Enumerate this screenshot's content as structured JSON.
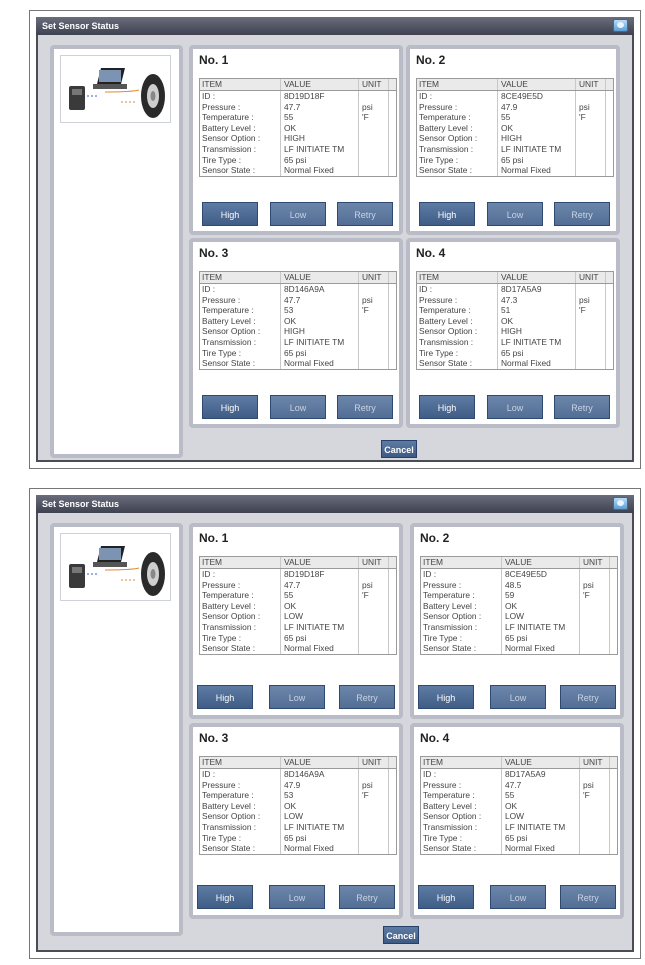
{
  "screens": [
    {
      "title": "Set Sensor Status",
      "cancel_label": "Cancel",
      "sensors": [
        {
          "no": "No. 1",
          "rows": [
            [
              "ID :",
              "8D19D18F",
              ""
            ],
            [
              "Pressure :",
              "47.7",
              "psi"
            ],
            [
              "Temperature :",
              "55",
              "'F"
            ],
            [
              "Battery Level :",
              "OK",
              ""
            ],
            [
              "Sensor Option :",
              "HIGH",
              ""
            ],
            [
              "Transmission :",
              "LF INITIATE TM",
              ""
            ],
            [
              "Tire Type :",
              "65 psi",
              ""
            ],
            [
              "Sensor State :",
              "Normal Fixed",
              ""
            ]
          ]
        },
        {
          "no": "No. 2",
          "rows": [
            [
              "ID :",
              "8CE49E5D",
              ""
            ],
            [
              "Pressure :",
              "47.9",
              "psi"
            ],
            [
              "Temperature :",
              "55",
              "'F"
            ],
            [
              "Battery Level :",
              "OK",
              ""
            ],
            [
              "Sensor Option :",
              "HIGH",
              ""
            ],
            [
              "Transmission :",
              "LF INITIATE TM",
              ""
            ],
            [
              "Tire Type :",
              "65 psi",
              ""
            ],
            [
              "Sensor State :",
              "Normal Fixed",
              ""
            ]
          ]
        },
        {
          "no": "No. 3",
          "rows": [
            [
              "ID :",
              "8D146A9A",
              ""
            ],
            [
              "Pressure :",
              "47.7",
              "psi"
            ],
            [
              "Temperature :",
              "53",
              "'F"
            ],
            [
              "Battery Level :",
              "OK",
              ""
            ],
            [
              "Sensor Option :",
              "HIGH",
              ""
            ],
            [
              "Transmission :",
              "LF INITIATE TM",
              ""
            ],
            [
              "Tire Type :",
              "65 psi",
              ""
            ],
            [
              "Sensor State :",
              "Normal Fixed",
              ""
            ]
          ]
        },
        {
          "no": "No. 4",
          "rows": [
            [
              "ID :",
              "8D17A5A9",
              ""
            ],
            [
              "Pressure :",
              "47.3",
              "psi"
            ],
            [
              "Temperature :",
              "51",
              "'F"
            ],
            [
              "Battery Level :",
              "OK",
              ""
            ],
            [
              "Sensor Option :",
              "HIGH",
              ""
            ],
            [
              "Transmission :",
              "LF INITIATE TM",
              ""
            ],
            [
              "Tire Type :",
              "65 psi",
              ""
            ],
            [
              "Sensor State :",
              "Normal Fixed",
              ""
            ]
          ]
        }
      ]
    },
    {
      "title": "Set Sensor Status",
      "cancel_label": "Cancel",
      "sensors": [
        {
          "no": "No. 1",
          "rows": [
            [
              "ID :",
              "8D19D18F",
              ""
            ],
            [
              "Pressure :",
              "47.7",
              "psi"
            ],
            [
              "Temperature :",
              "55",
              "'F"
            ],
            [
              "Battery Level :",
              "OK",
              ""
            ],
            [
              "Sensor Option :",
              "LOW",
              ""
            ],
            [
              "Transmission :",
              "LF INITIATE TM",
              ""
            ],
            [
              "Tire Type :",
              "65 psi",
              ""
            ],
            [
              "Sensor State :",
              "Normal Fixed",
              ""
            ]
          ]
        },
        {
          "no": "No. 2",
          "rows": [
            [
              "ID :",
              "8CE49E5D",
              ""
            ],
            [
              "Pressure :",
              "48.5",
              "psi"
            ],
            [
              "Temperature :",
              "59",
              "'F"
            ],
            [
              "Battery Level :",
              "OK",
              ""
            ],
            [
              "Sensor Option :",
              "LOW",
              ""
            ],
            [
              "Transmission :",
              "LF INITIATE TM",
              ""
            ],
            [
              "Tire Type :",
              "65 psi",
              ""
            ],
            [
              "Sensor State :",
              "Normal Fixed",
              ""
            ]
          ]
        },
        {
          "no": "No. 3",
          "rows": [
            [
              "ID :",
              "8D146A9A",
              ""
            ],
            [
              "Pressure :",
              "47.9",
              "psi"
            ],
            [
              "Temperature :",
              "53",
              "'F"
            ],
            [
              "Battery Level :",
              "OK",
              ""
            ],
            [
              "Sensor Option :",
              "LOW",
              ""
            ],
            [
              "Transmission :",
              "LF INITIATE TM",
              ""
            ],
            [
              "Tire Type :",
              "65 psi",
              ""
            ],
            [
              "Sensor State :",
              "Normal Fixed",
              ""
            ]
          ]
        },
        {
          "no": "No. 4",
          "rows": [
            [
              "ID :",
              "8D17A5A9",
              ""
            ],
            [
              "Pressure :",
              "47.7",
              "psi"
            ],
            [
              "Temperature :",
              "55",
              "'F"
            ],
            [
              "Battery Level :",
              "OK",
              ""
            ],
            [
              "Sensor Option :",
              "LOW",
              ""
            ],
            [
              "Transmission :",
              "LF INITIATE TM",
              ""
            ],
            [
              "Tire Type :",
              "65 psi",
              ""
            ],
            [
              "Sensor State :",
              "Normal Fixed",
              ""
            ]
          ]
        }
      ]
    }
  ],
  "table_headers": {
    "item": "ITEM",
    "value": "VALUE",
    "unit": "UNIT"
  },
  "buttons": {
    "high": "High",
    "low": "Low",
    "retry": "Retry"
  },
  "icons": {
    "title_icon": "window-icon",
    "illustration": "scan-tool-laptop-sensor-tire-icon"
  },
  "colors": {
    "window_dark": "#4a4c56",
    "panel_border": "#b9bcc6",
    "button": "#4f6d96"
  }
}
